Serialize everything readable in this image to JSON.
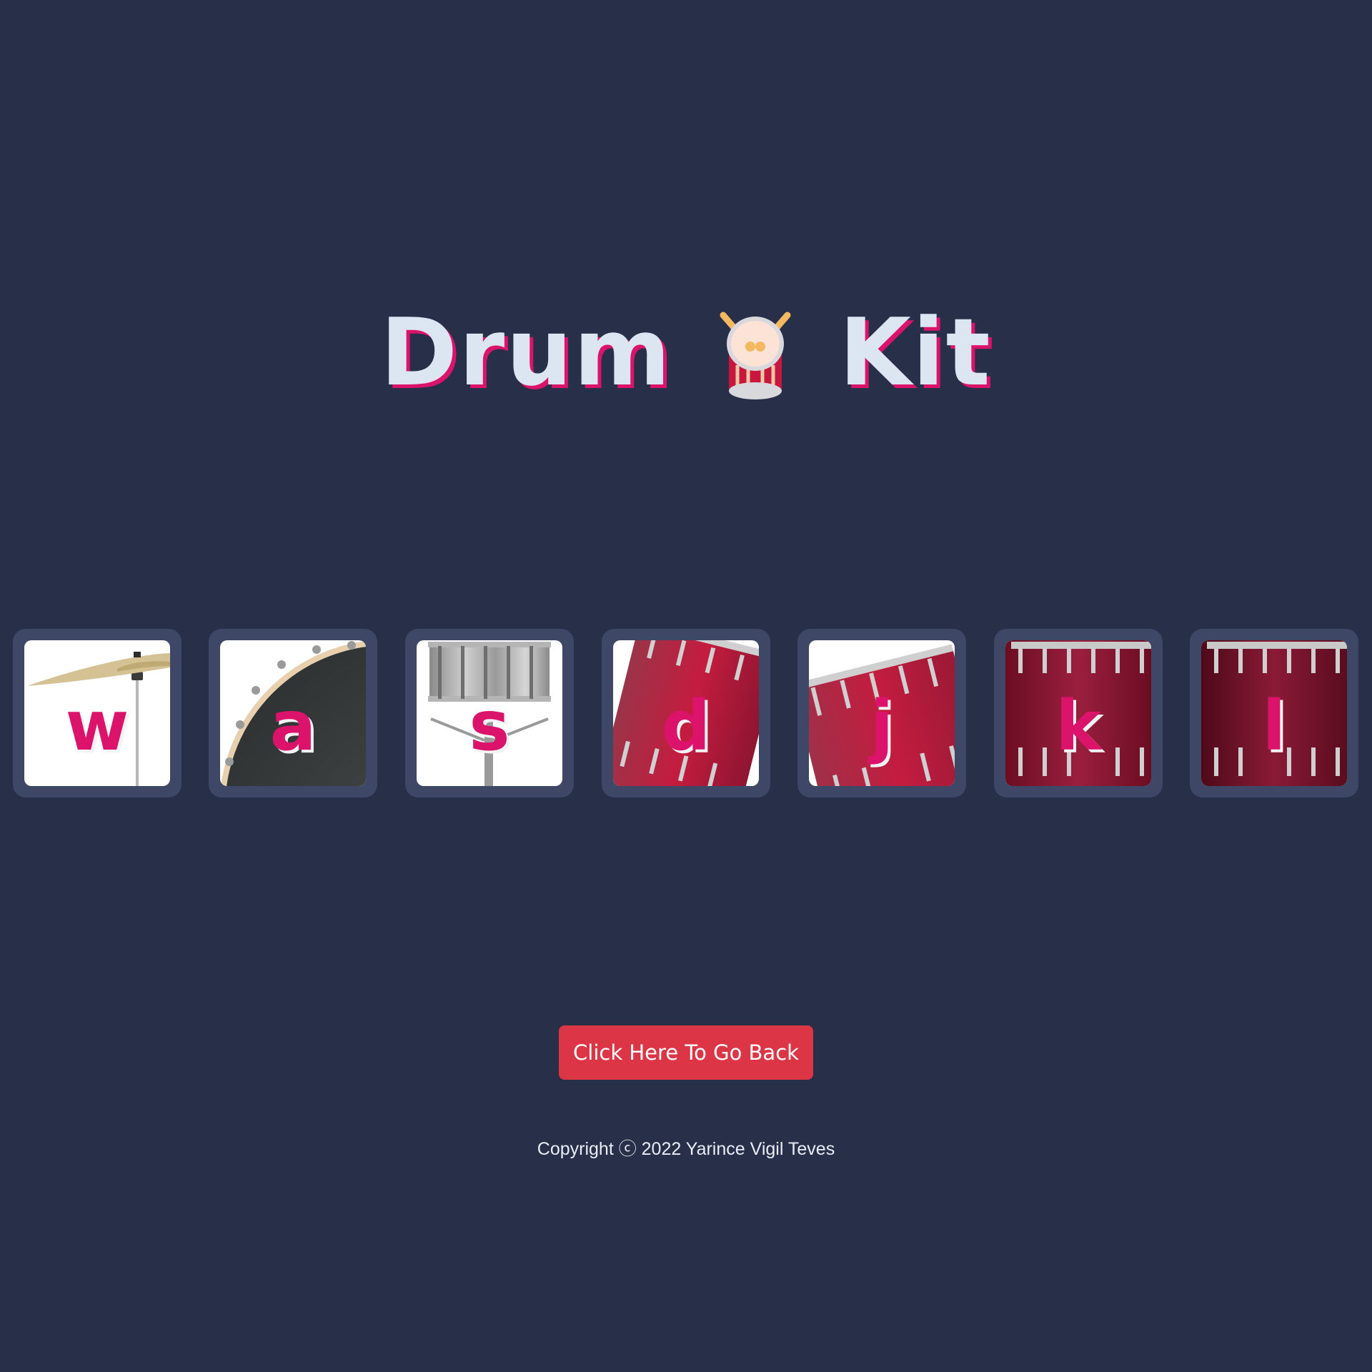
{
  "header": {
    "title_left": "Drum",
    "title_right": "Kit",
    "title_icon": "drum-emoji-icon"
  },
  "keys": [
    {
      "letter": "w",
      "instrument": "crash-cymbal"
    },
    {
      "letter": "a",
      "instrument": "kick-drum"
    },
    {
      "letter": "s",
      "instrument": "snare-drum"
    },
    {
      "letter": "d",
      "instrument": "tom-1"
    },
    {
      "letter": "j",
      "instrument": "tom-2"
    },
    {
      "letter": "k",
      "instrument": "tom-3"
    },
    {
      "letter": "l",
      "instrument": "tom-4"
    }
  ],
  "back_button": {
    "label": "Click Here To Go Back"
  },
  "footer": {
    "copyright": "Copyright ⓒ 2022 Yarince Vigil Teves"
  },
  "colors": {
    "background": "#283049",
    "key_frame": "#3e4866",
    "accent_pink": "#dc136b",
    "title_text": "#dbe6f2",
    "button_red": "#dc3545"
  }
}
